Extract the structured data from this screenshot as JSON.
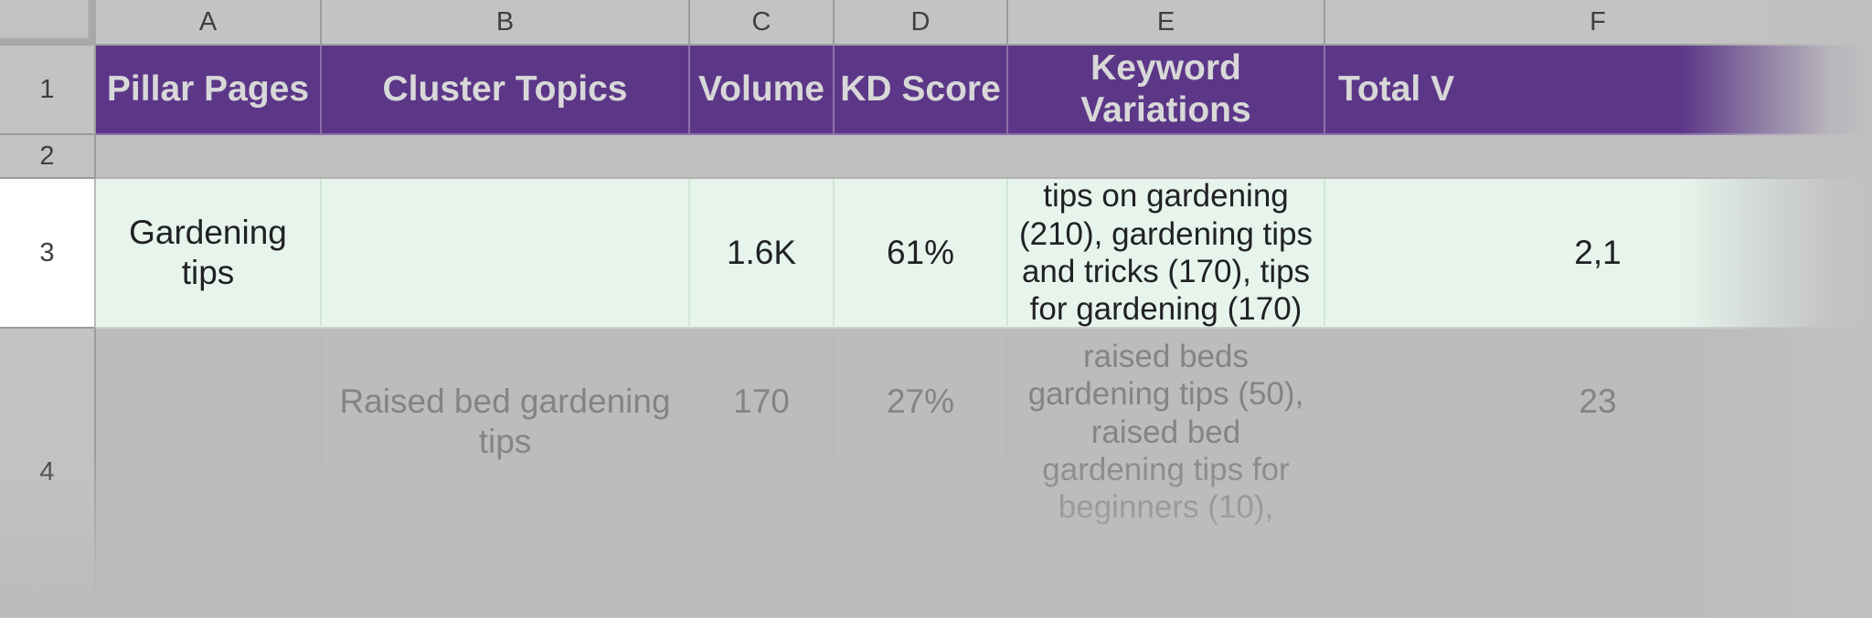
{
  "app": {
    "type": "spreadsheet",
    "accent_color": "#5c3788",
    "header_text_color": "#d8d8d8",
    "selected_row_color": "#e7f4ec",
    "grid_background": "#c0c0c0",
    "dimmed_row_color": "#bcbcbc"
  },
  "grid": {
    "column_labels": [
      "A",
      "B",
      "C",
      "D",
      "E",
      "F"
    ],
    "row_labels": [
      "1",
      "2",
      "3",
      "4"
    ],
    "selected_row": "3"
  },
  "table": {
    "headers": [
      "Pillar Pages",
      "Cluster Topics",
      "Volume",
      "KD Score",
      "Keyword Variations",
      "Total V"
    ],
    "blank_row": {
      "row_label": "2",
      "a": "",
      "b": "",
      "c": "",
      "d": "",
      "e": "",
      "f": ""
    },
    "rows": [
      {
        "row_label": "3",
        "pillar_pages": "Gardening tips",
        "cluster_topics": "",
        "volume": "1.6K",
        "kd_score": "61%",
        "keyword_variations": "tips on gardening (210), gardening tips and tricks (170), tips for gardening (170)",
        "total_volume": "2,1"
      },
      {
        "row_label": "4",
        "pillar_pages": "",
        "cluster_topics": "Raised bed gardening tips",
        "volume": "170",
        "kd_score": "27%",
        "keyword_variations": "raised beds gardening tips (50), raised bed gardening tips for beginners (10),",
        "total_volume": "23"
      }
    ]
  }
}
